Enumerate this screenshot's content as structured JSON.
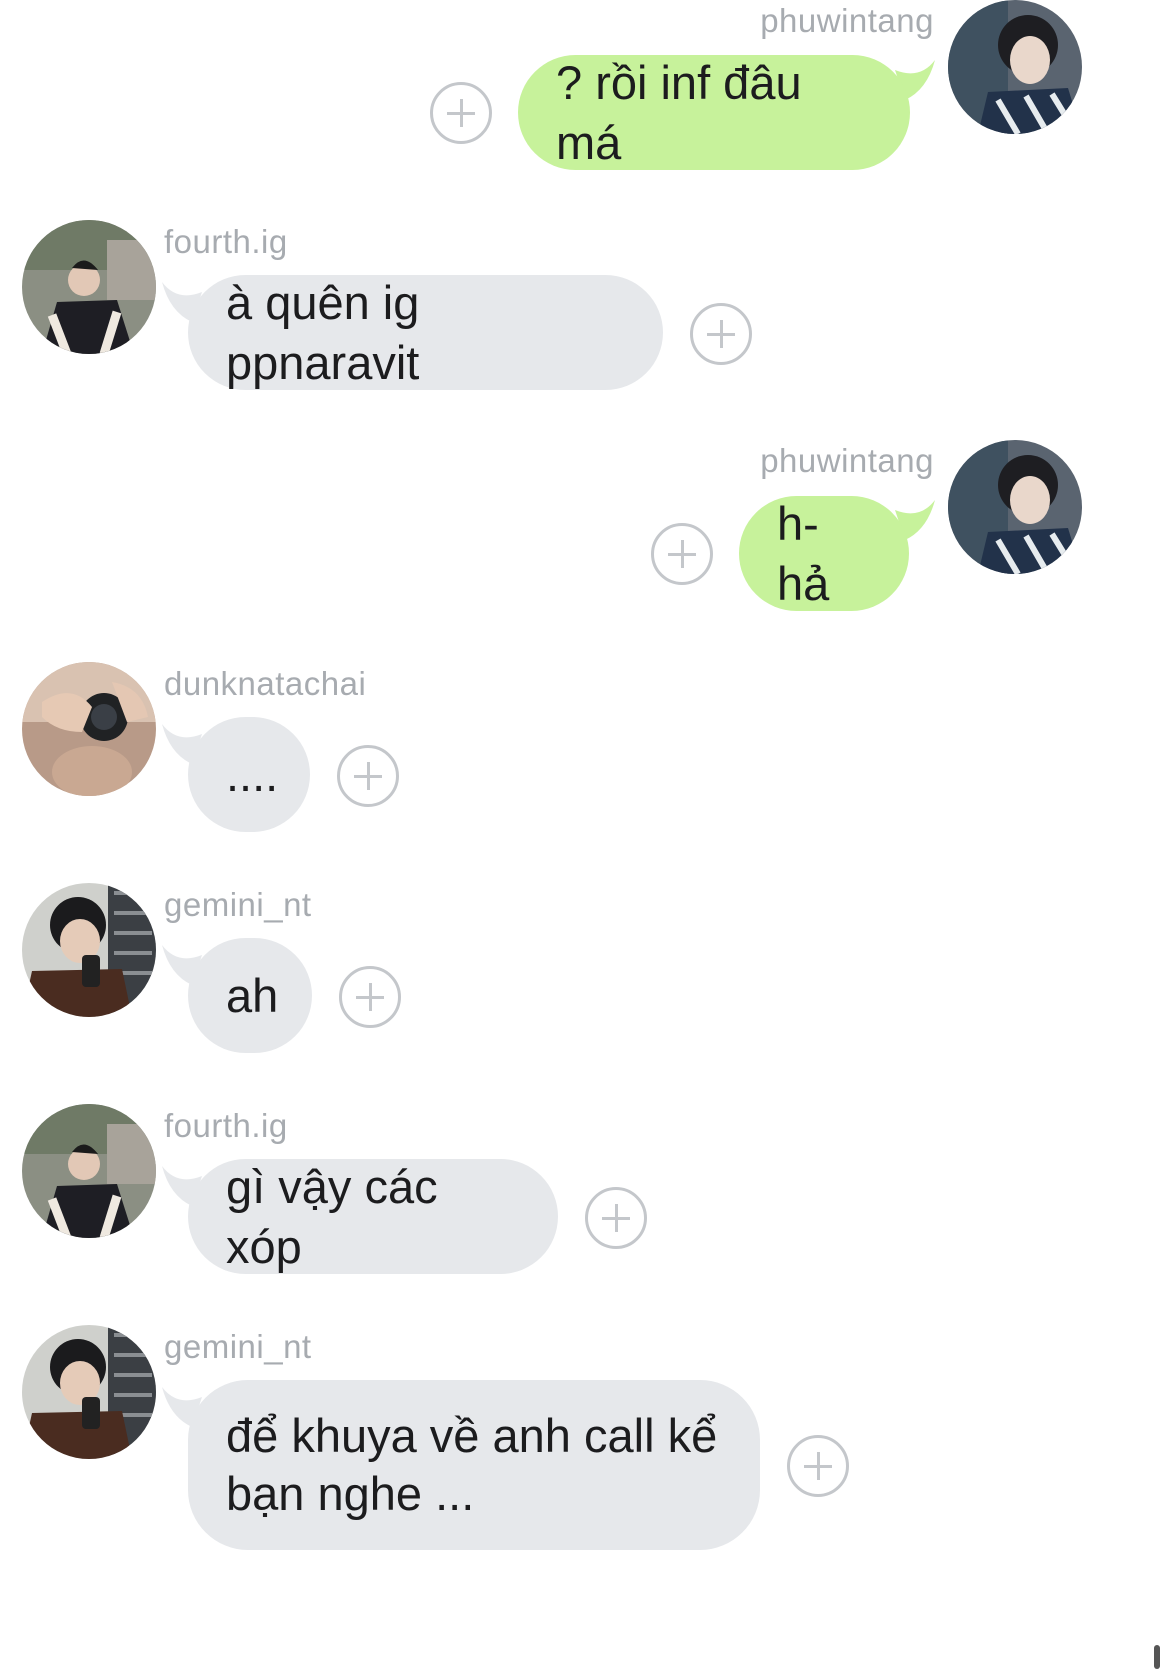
{
  "messages": [
    {
      "sender": "phuwintang",
      "text": "? rồi inf đâu má",
      "direction": "sent",
      "avatar": "avatar-phuwintang"
    },
    {
      "sender": "fourth.ig",
      "text": "à quên ig ppnaravit",
      "direction": "received",
      "avatar": "avatar-fourth"
    },
    {
      "sender": "phuwintang",
      "text": "h-hả",
      "direction": "sent",
      "avatar": "avatar-phuwintang"
    },
    {
      "sender": "dunknatachai",
      "text": "....",
      "direction": "received",
      "avatar": "avatar-dunk"
    },
    {
      "sender": "gemini_nt",
      "text": "ah",
      "direction": "received",
      "avatar": "avatar-gemini"
    },
    {
      "sender": "fourth.ig",
      "text": "gì vậy các xóp",
      "direction": "received",
      "avatar": "avatar-fourth"
    },
    {
      "sender": "gemini_nt",
      "text": "để khuya về anh call kể bạn nghe ...",
      "direction": "received",
      "avatar": "avatar-gemini"
    }
  ],
  "colors": {
    "sent_bubble": "#c7f29b",
    "received_bubble": "#e6e8eb",
    "name_text": "#a7abb0",
    "plus_icon": "#c4c7cb"
  },
  "icons": {
    "reaction": "plus-circle-icon"
  }
}
